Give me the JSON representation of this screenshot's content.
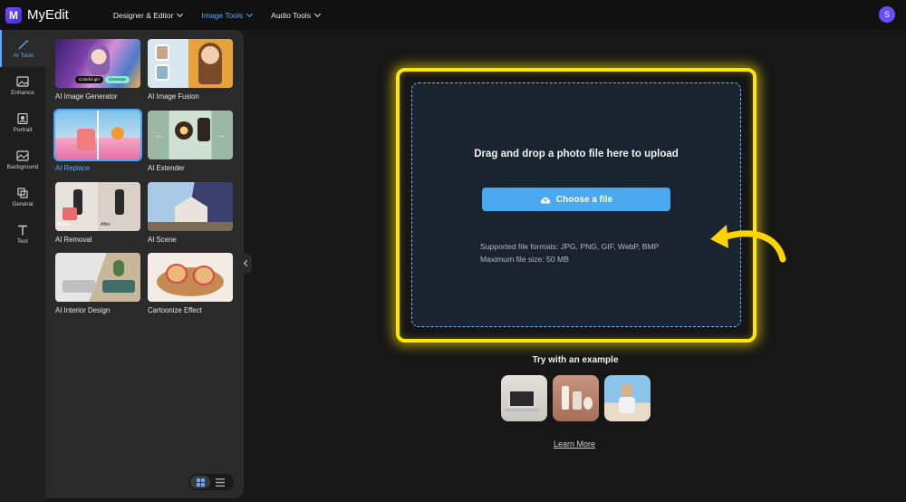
{
  "header": {
    "brand": "MyEdit",
    "logo_letter": "M",
    "nav": [
      {
        "label": "Designer & Editor",
        "active": false
      },
      {
        "label": "Image Tools",
        "active": true
      },
      {
        "label": "Audio Tools",
        "active": false
      }
    ],
    "avatar_initial": "S"
  },
  "rail": {
    "items": [
      {
        "label": "AI Tools",
        "icon": "magic-wand-icon",
        "active": true
      },
      {
        "label": "Enhance",
        "icon": "image-enhance-icon",
        "active": false
      },
      {
        "label": "Portrait",
        "icon": "portrait-icon",
        "active": false
      },
      {
        "label": "Background",
        "icon": "background-icon",
        "active": false
      },
      {
        "label": "General",
        "icon": "crop-icon",
        "active": false
      },
      {
        "label": "Text",
        "icon": "text-icon",
        "active": false
      }
    ]
  },
  "tools": {
    "items": [
      {
        "label": "AI Image Generator",
        "thumb_badges": [
          "Colorful girl",
          "Generate"
        ]
      },
      {
        "label": "AI Image Fusion"
      },
      {
        "label": "AI Replace",
        "active": true
      },
      {
        "label": "AI Extender"
      },
      {
        "label": "AI Removal",
        "thumb_badges": [
          "Before",
          "After"
        ]
      },
      {
        "label": "AI Scene"
      },
      {
        "label": "AI Interior Design"
      },
      {
        "label": "Cartoonize Effect"
      }
    ]
  },
  "upload": {
    "title": "Drag and drop a photo file here to upload",
    "button_label": "Choose a file",
    "formats_line": "Supported file formats: JPG, PNG, GIF, WebP, BMP",
    "size_line": "Maximum file size: 50 MB"
  },
  "examples": {
    "title": "Try with an example",
    "learn_more": "Learn More"
  },
  "colors": {
    "accent": "#4aa8ef",
    "highlight": "#ffe600",
    "brand": "#6c4cff"
  }
}
